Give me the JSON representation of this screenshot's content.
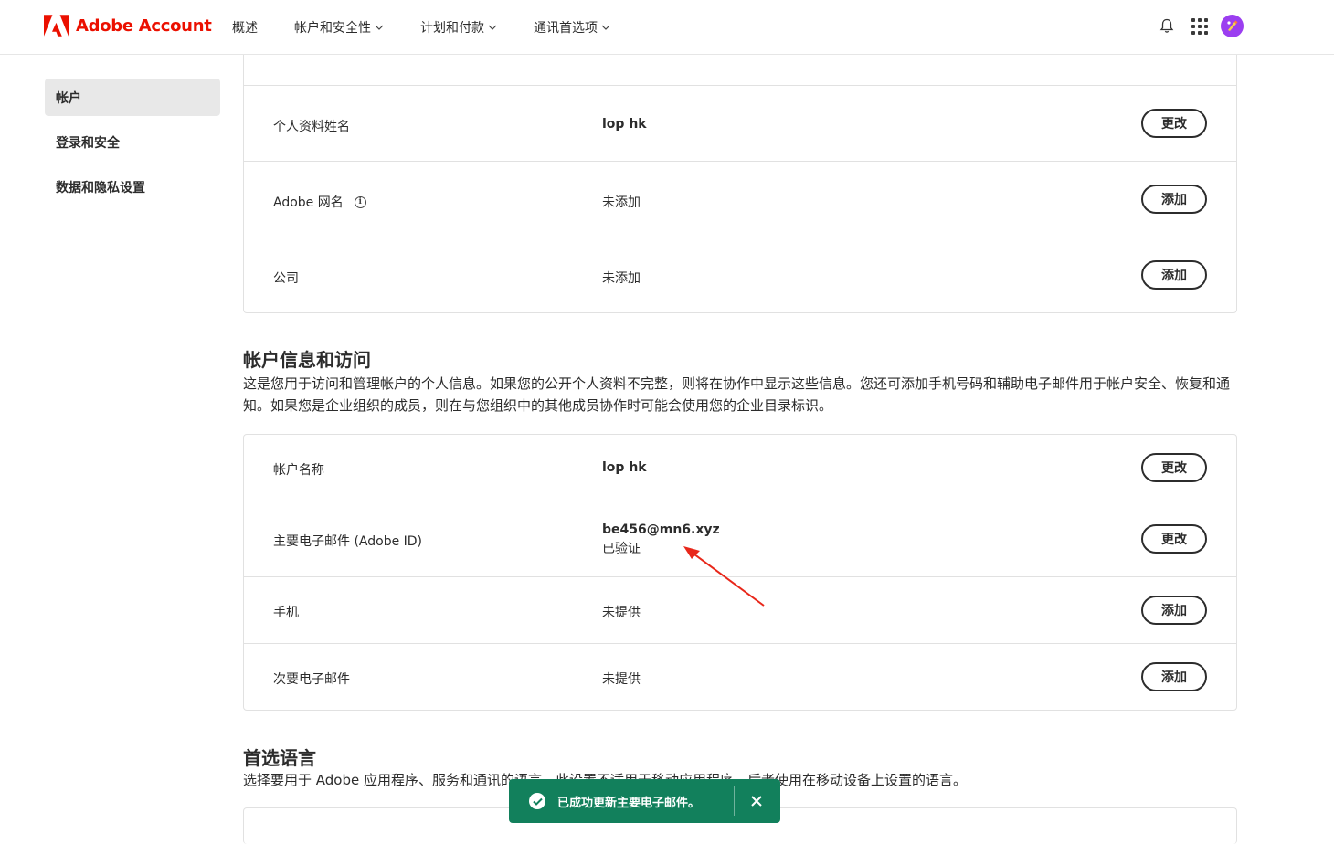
{
  "header": {
    "brand": "Adobe Account",
    "brand_color": "#eb1000",
    "nav": [
      {
        "label": "概述",
        "has_dropdown": false
      },
      {
        "label": "帐户和安全性",
        "has_dropdown": true
      },
      {
        "label": "计划和付款",
        "has_dropdown": true
      },
      {
        "label": "通讯首选项",
        "has_dropdown": true
      }
    ],
    "icons": [
      "bell-icon",
      "apps-grid-icon",
      "avatar"
    ]
  },
  "sidebar": {
    "items": [
      {
        "label": "帐户",
        "active": true
      },
      {
        "label": "登录和安全",
        "active": false
      },
      {
        "label": "数据和隐私设置",
        "active": false
      }
    ]
  },
  "profile_card": {
    "rows": [
      {
        "label": "个人资料姓名",
        "value": "lop hk",
        "action": "更改"
      },
      {
        "label": "Adobe 网名",
        "value": "未添加",
        "action": "添加"
      },
      {
        "label": "公司",
        "value": "未添加",
        "action": "添加"
      }
    ]
  },
  "account_section": {
    "title": "帐户信息和访问",
    "description": "这是您用于访问和管理帐户的个人信息。如果您的公开个人资料不完整，则将在协作中显示这些信息。您还可添加手机号码和辅助电子邮件用于帐户安全、恢复和通知。如果您是企业组织的成员，则在与您组织中的其他成员协作时可能会使用您的企业目录标识。",
    "rows": [
      {
        "label": "帐户名称",
        "value": "lop hk",
        "action": "更改"
      },
      {
        "label": "主要电子邮件 (Adobe ID)",
        "value": "be456@mn6.xyz",
        "sub": "已验证",
        "action": "更改"
      },
      {
        "label": "手机",
        "value": "未提供",
        "action": "添加"
      },
      {
        "label": "次要电子邮件",
        "value": "未提供",
        "action": "添加"
      }
    ]
  },
  "language_section": {
    "title": "首选语言",
    "description": "选择要用于 Adobe 应用程序、服务和通讯的语言。此设置不适用于移动应用程序，后者使用在移动设备上设置的语言。"
  },
  "toast": {
    "message": "已成功更新主要电子邮件。",
    "color": "#12805c"
  },
  "annotation": {
    "color": "#e8271a"
  }
}
